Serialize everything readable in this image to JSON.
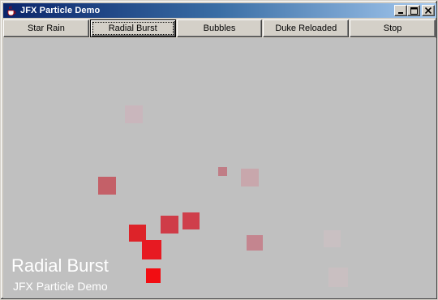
{
  "window": {
    "title": "JFX Particle Demo",
    "icon": "java-cup-icon",
    "controls": [
      "minimize-icon",
      "maximize-icon",
      "close-icon"
    ]
  },
  "toolbar": {
    "buttons": [
      {
        "label": "Star Rain"
      },
      {
        "label": "Radial Burst"
      },
      {
        "label": "Bubbles"
      },
      {
        "label": "Duke Reloaded"
      },
      {
        "label": "Stop"
      }
    ],
    "selected": "Radial Burst"
  },
  "canvas": {
    "overlay_title": "Radial Burst",
    "overlay_subtitle": "JFX Particle Demo",
    "colors": {
      "background": "#c0c0c0",
      "particle_strong": "#f20d12",
      "particle_faded": "#c9b6bc"
    }
  }
}
